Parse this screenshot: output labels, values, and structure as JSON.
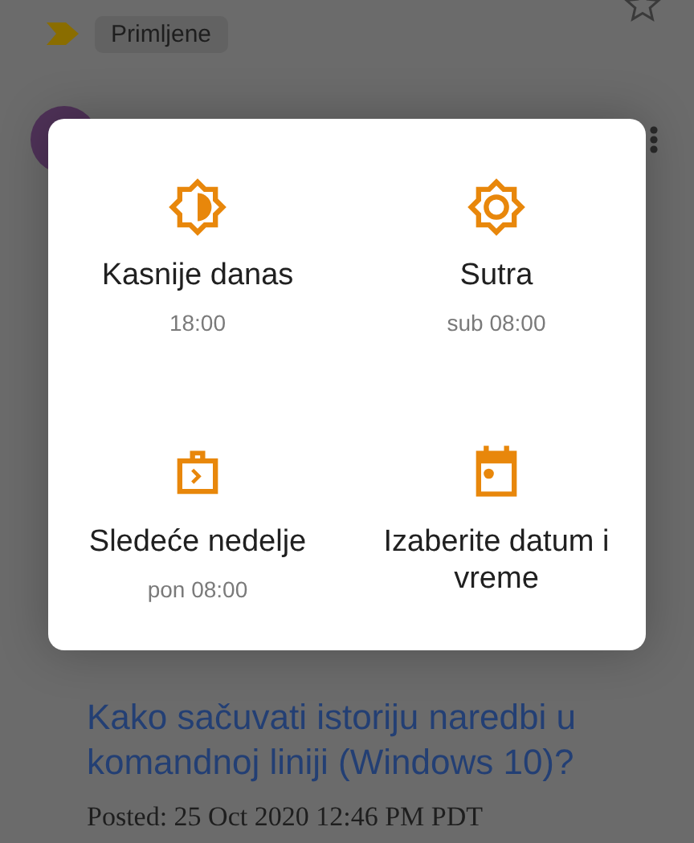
{
  "header": {
    "label": "Primljene"
  },
  "dialog": {
    "options": [
      {
        "kind": "later",
        "title": "Kasnije danas",
        "time": "18:00"
      },
      {
        "kind": "tomorrow",
        "title": "Sutra",
        "time": "sub 08:00"
      },
      {
        "kind": "week",
        "title": "Sledeće nedelje",
        "time": "pon 08:00"
      },
      {
        "kind": "pick",
        "title": "Izaberite datum i vreme"
      }
    ]
  },
  "post": {
    "title": "Kako sačuvati istoriju naredbi u komandnoj liniji (Windows 10)?",
    "posted": "Posted: 25 Oct 2020 12:46 PM PDT"
  }
}
